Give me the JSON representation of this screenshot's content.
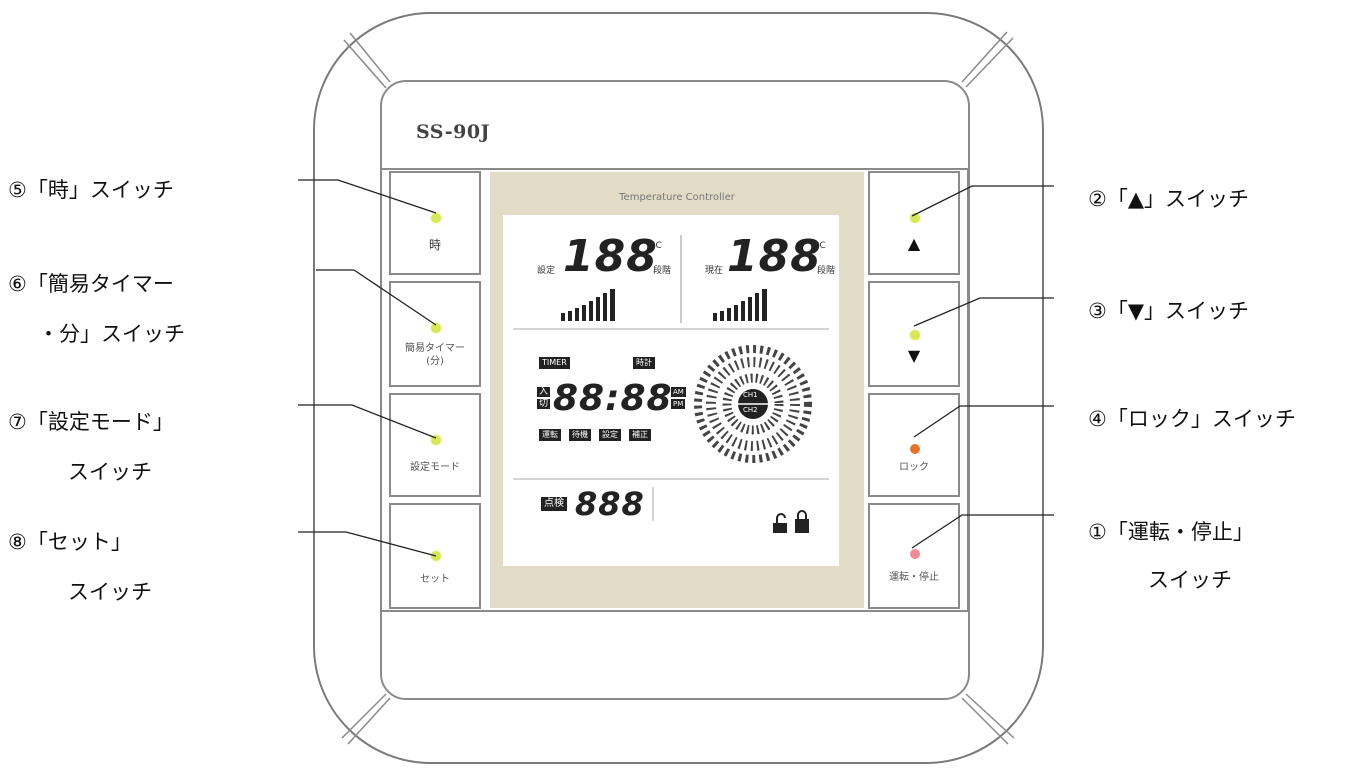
{
  "device": {
    "model": "SS-90J",
    "panel_title": "Temperature Controller"
  },
  "buttons": {
    "hour": {
      "label": "時"
    },
    "timer_minute": {
      "label_line1": "簡易タイマー",
      "label_line2": "(分)"
    },
    "setting_mode": {
      "label": "設定モード"
    },
    "set": {
      "label": "セット"
    },
    "up": {
      "label": "▲"
    },
    "down": {
      "label": "▼"
    },
    "lock": {
      "label": "ロック"
    },
    "run_stop": {
      "label": "運転・停止"
    }
  },
  "display": {
    "set_label": "設定",
    "current_label": "現在",
    "set_value": "188",
    "current_value": "188",
    "celsius": "°C",
    "stage_label": "段階",
    "timer_tag": "TIMER",
    "clock_tag": "時計",
    "on_off_tag_top": "入",
    "on_off_tag_bottom": "切",
    "time_value": "88:88",
    "am": "AM",
    "pm": "PM",
    "mode_tags": [
      "運転",
      "待機",
      "設定",
      "補正"
    ],
    "ch1": "CH1",
    "ch2": "CH2",
    "check_tag": "点検",
    "check_value": "888"
  },
  "callouts": {
    "c5": "⑤「時」スイッチ",
    "c6_line1": "⑥「簡易タイマー",
    "c6_line2": "・分」スイッチ",
    "c7_line1": "⑦「設定モード」",
    "c7_line2": "スイッチ",
    "c8_line1": "⑧「セット」",
    "c8_line2": "スイッチ",
    "c2": "②「▲」スイッチ",
    "c3": "③「▼」スイッチ",
    "c4": "④「ロック」スイッチ",
    "c1_line1": "①「運転・停止」",
    "c1_line2": "スイッチ"
  },
  "colors": {
    "panel_beige": "#e2dcc6",
    "led_green": "#d6e85a",
    "led_orange": "#e8732a",
    "led_pink": "#f08a96"
  }
}
